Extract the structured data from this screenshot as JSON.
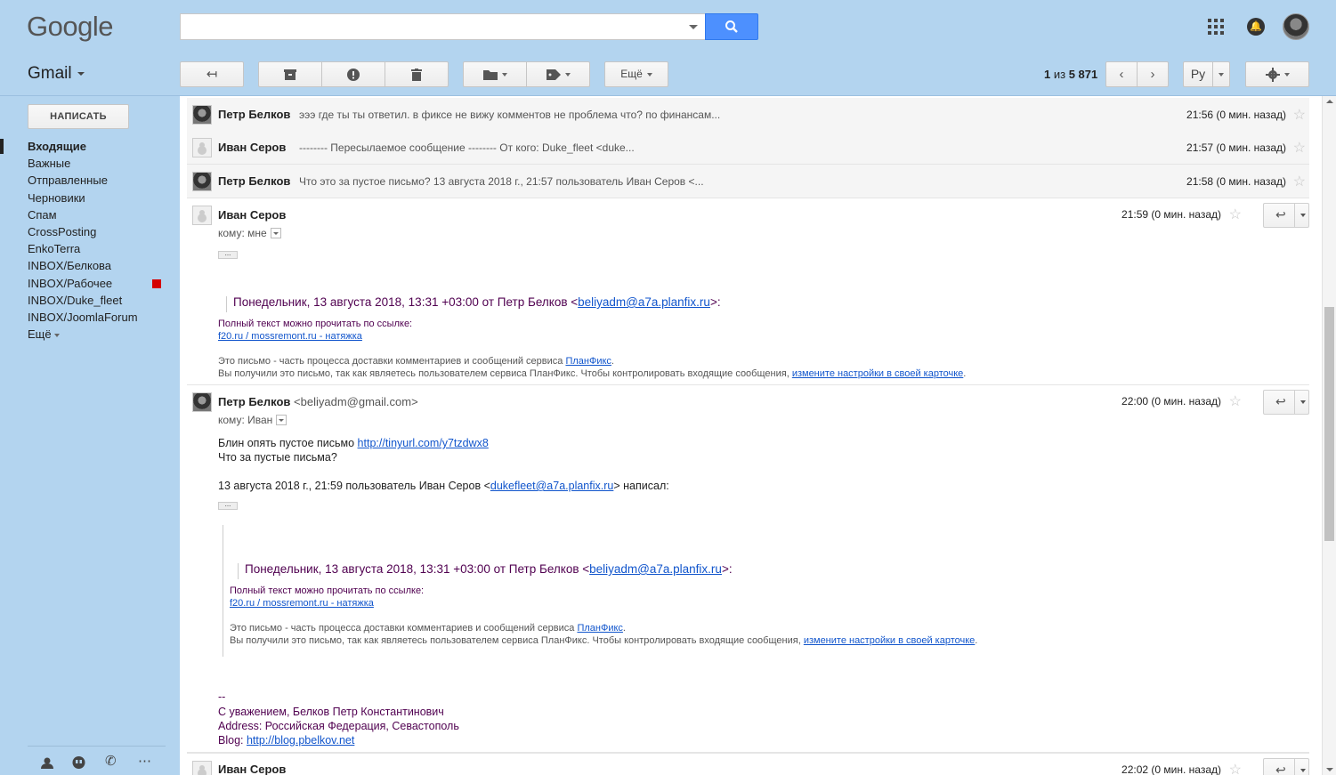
{
  "header": {
    "logo": "Google",
    "search_placeholder": ""
  },
  "toolbar": {
    "app_name": "Gmail",
    "more_label": "Ещё",
    "pager_current": "1",
    "pager_sep": " из ",
    "pager_total": "5 871",
    "lang_label": "Ру"
  },
  "sidebar": {
    "compose_label": "НАПИСАТЬ",
    "items": [
      {
        "label": "Входящие"
      },
      {
        "label": "Важные"
      },
      {
        "label": "Отправленные"
      },
      {
        "label": "Черновики"
      },
      {
        "label": "Спам"
      },
      {
        "label": "CrossPosting"
      },
      {
        "label": "EnkoTerra"
      },
      {
        "label": "INBOX/Белкова"
      },
      {
        "label": "INBOX/Рабочее"
      },
      {
        "label": "INBOX/Duke_fleet"
      },
      {
        "label": "INBOX/JoomlaForum"
      },
      {
        "label": "Ещё"
      }
    ],
    "label_color": "#d50000"
  },
  "thread": {
    "collapsed": [
      {
        "from": "Петр Белков",
        "snippet": "эээ где ты ты ответил. в фиксе не вижу комментов не проблема что? по финансам...",
        "time": "21:56 (0 мин. назад)"
      },
      {
        "from": "Иван Серов",
        "snippet": "-------- Пересылаемое сообщение -------- От кого: Duke_fleet <duke...",
        "time": "21:57 (0 мин. назад)"
      },
      {
        "from": "Петр Белков",
        "snippet": "Что это за пустое письмо? 13 августа 2018 г., 21:57 пользователь Иван Серов <...",
        "time": "21:58 (0 мин. назад)"
      }
    ],
    "msg1": {
      "from": "Иван Серов",
      "to": "кому: мне",
      "time": "21:59 (0 мин. назад)",
      "quote_head": "Понедельник, 13 августа 2018, 13:31 +03:00 от Петр Белков <",
      "quote_email": "beliyadm@a7a.planfix.ru",
      "quote_tail": ">:",
      "fulltext": "Полный текст можно прочитать по ссылке:",
      "link": "f20.ru / mossremont.ru - натяжка",
      "note1": "Это письмо - часть процесса доставки комментариев и сообщений сервиса ",
      "note1_link": "ПланФикс",
      "note2": "Вы получили это письмо, так как являетесь пользователем сервиса ПланФикс. Чтобы контролировать входящие сообщения, ",
      "note2_link": "измените настройки в своей карточке",
      "dot": "."
    },
    "msg2": {
      "from": "Петр Белков",
      "from_email": "<beliyadm@gmail.com>",
      "to": "кому: Иван",
      "time": "22:00 (0 мин. назад)",
      "line1": "Блин опять пустое письмо ",
      "line1_link": "http://tinyurl.com/y7tzdwx8",
      "line2": "Что за пустые письма?",
      "line3": "13 августа 2018 г., 21:59 пользователь Иван Серов <",
      "line3_link": "dukefleet@a7a.planfix.ru",
      "line3_tail": "> написал:",
      "quote_head": "Понедельник, 13 августа 2018, 13:31 +03:00 от Петр Белков <",
      "quote_email": "beliyadm@a7a.planfix.ru",
      "quote_tail": ">:",
      "fulltext": "Полный текст можно прочитать по ссылке:",
      "link": "f20.ru / mossremont.ru - натяжка",
      "note1": "Это письмо - часть процесса доставки комментариев и сообщений сервиса ",
      "note1_link": "ПланФикс",
      "note2": "Вы получили это письмо, так как являетесь пользователем сервиса ПланФикс. Чтобы контролировать входящие сообщения, ",
      "note2_link": "измените настройки в своей карточке",
      "dot": ".",
      "sig_dash": "--",
      "sig1": "С уважением, Белков Петр Константинович",
      "sig2": "Address: Российская Федерация, Севастополь",
      "sig3_label": "Blog: ",
      "sig3_link": "http://blog.pbelkov.net"
    },
    "msg3": {
      "from": "Иван Серов",
      "time": "22:02 (0 мин. назад)"
    }
  },
  "colors": {
    "chrome_bg": "#b3d4ef",
    "search_btn": "#4d90fe",
    "link": "#1155cc",
    "quote_text": "#500050"
  }
}
